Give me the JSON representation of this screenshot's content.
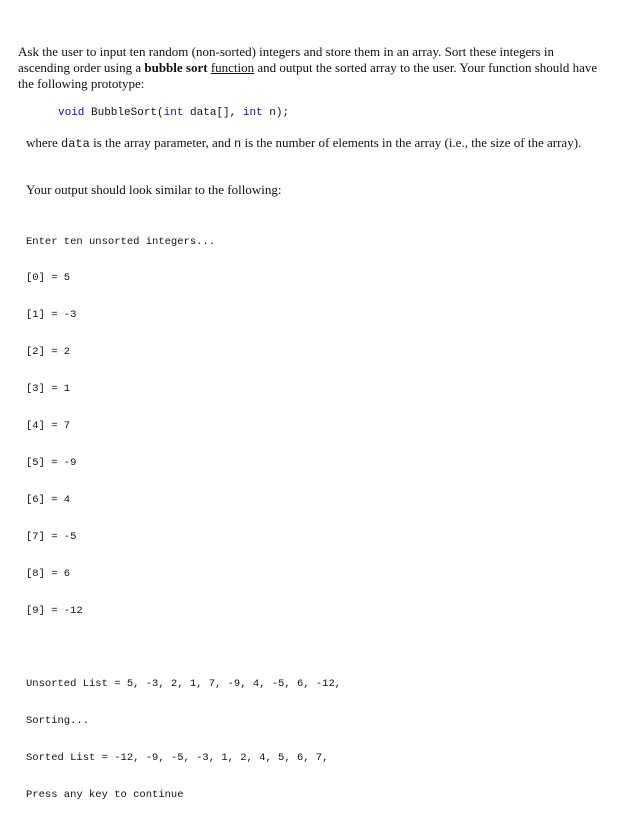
{
  "intro": {
    "part1": "Ask the user to input ten random (non-sorted) integers and store them in an array.  Sort these integers in ascending order using a ",
    "bold": "bubble sort",
    "space": " ",
    "underlined": "function",
    "part2": " and output the sorted array to the user.  Your function should have the following prototype:"
  },
  "prototype": {
    "kw_void": "void",
    "name": " BubbleSort(",
    "kw_int1": "int",
    "param1": " data[], ",
    "kw_int2": "int",
    "param2": " n);"
  },
  "where": {
    "prefix": "where ",
    "code1": "data",
    "mid": " is the array parameter, and ",
    "code2": "n",
    "suffix": " is the number of elements in the array (i.e., the size of the array)."
  },
  "output_heading": "Your output should look similar to the following:",
  "console": {
    "prompt": "Enter ten unsorted integers...",
    "entries": [
      "[0] = 5",
      "[1] = -3",
      "[2] = 2",
      "[3] = 1",
      "[4] = 7",
      "[5] = -9",
      "[6] = 4",
      "[7] = -5",
      "[8] = 6",
      "[9] = -12"
    ],
    "unsorted": "Unsorted List = 5, -3, 2, 1, 7, -9, 4, -5, 6, -12,",
    "sorting": "Sorting...",
    "sorted": "Sorted List = -12, -9, -5, -3, 1, 2, 4, 5, 6, 7,",
    "press": "Press any key to continue"
  }
}
